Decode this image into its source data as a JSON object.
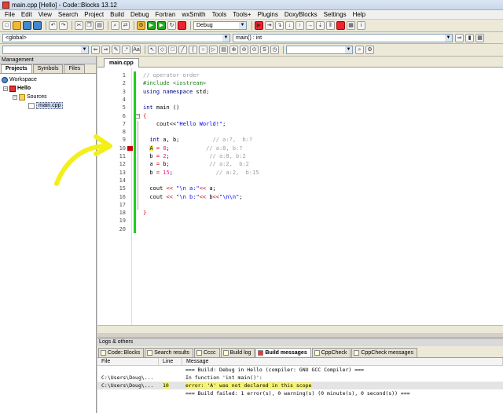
{
  "window": {
    "title": "main.cpp [Hello] - Code::Blocks 13.12"
  },
  "menu": [
    "File",
    "Edit",
    "View",
    "Search",
    "Project",
    "Build",
    "Debug",
    "Fortran",
    "wxSmith",
    "Tools",
    "Tools+",
    "Plugins",
    "DoxyBlocks",
    "Settings",
    "Help"
  ],
  "toolbar": {
    "build_target": "Debug",
    "scope": "<global>",
    "function": "main() : int"
  },
  "management": {
    "title": "Management",
    "tabs": [
      "Projects",
      "Symbols",
      "Files"
    ],
    "tree": {
      "workspace": "Workspace",
      "project": "Hello",
      "folder": "Sources",
      "file": "main.cpp"
    }
  },
  "editor": {
    "tab": "main.cpp",
    "lines": [
      [
        [
          "c-comment",
          "// operator order"
        ]
      ],
      [
        [
          "c-pre",
          "#include <iostream>"
        ]
      ],
      [
        [
          "c-kw",
          "using namespace"
        ],
        [
          "c-plain",
          " std;"
        ]
      ],
      [
        [
          "c-plain",
          ""
        ]
      ],
      [
        [
          "c-kw",
          "int"
        ],
        [
          "c-plain",
          " main ()"
        ]
      ],
      [
        [
          "c-op",
          "{"
        ]
      ],
      [
        [
          "c-plain",
          "    cout<<"
        ],
        [
          "c-str",
          "\"Hello World!\""
        ],
        [
          "c-plain",
          ";"
        ]
      ],
      [
        [
          "c-plain",
          ""
        ]
      ],
      [
        [
          "c-plain",
          "  "
        ],
        [
          "c-kw",
          "int"
        ],
        [
          "c-plain",
          " a, b;          "
        ],
        [
          "c-comment",
          "// a:?,  b:?"
        ]
      ],
      [
        [
          "c-plain",
          "  "
        ],
        [
          "c-plain hilite",
          "A"
        ],
        [
          "c-op",
          " = "
        ],
        [
          "c-num",
          "8"
        ],
        [
          "c-plain",
          ";           "
        ],
        [
          "c-comment",
          "// a:8, b:?"
        ]
      ],
      [
        [
          "c-plain",
          "  b "
        ],
        [
          "c-op",
          "="
        ],
        [
          "c-plain",
          " "
        ],
        [
          "c-num",
          "2"
        ],
        [
          "c-plain",
          ";            "
        ],
        [
          "c-comment",
          "// a:8, b:2"
        ]
      ],
      [
        [
          "c-plain",
          "  a "
        ],
        [
          "c-op",
          "="
        ],
        [
          "c-plain",
          " b;            "
        ],
        [
          "c-comment",
          "// a:2,  b:2"
        ]
      ],
      [
        [
          "c-plain",
          "  b "
        ],
        [
          "c-op",
          "="
        ],
        [
          "c-plain",
          " "
        ],
        [
          "c-num",
          "15"
        ],
        [
          "c-plain",
          ";             "
        ],
        [
          "c-comment",
          "// a:2,  b:15"
        ]
      ],
      [
        [
          "c-plain",
          ""
        ]
      ],
      [
        [
          "c-plain",
          "  cout "
        ],
        [
          "c-op",
          "<<"
        ],
        [
          "c-plain",
          " "
        ],
        [
          "c-str",
          "\"\\n a:\""
        ],
        [
          "c-op",
          "<<"
        ],
        [
          "c-plain",
          " a;"
        ]
      ],
      [
        [
          "c-plain",
          "  cout "
        ],
        [
          "c-op",
          "<<"
        ],
        [
          "c-plain",
          " "
        ],
        [
          "c-str",
          "\"\\n b:\""
        ],
        [
          "c-op",
          "<<"
        ],
        [
          "c-plain",
          " b"
        ],
        [
          "c-op",
          "<<"
        ],
        [
          "c-str",
          "\"\\n\\n\""
        ],
        [
          "c-plain",
          ";"
        ]
      ],
      [
        [
          "c-plain",
          ""
        ]
      ],
      [
        [
          "c-op",
          "}"
        ]
      ],
      [
        [
          "c-plain",
          ""
        ]
      ],
      [
        [
          "c-plain",
          ""
        ]
      ]
    ],
    "line_numbers": [
      "1",
      "2",
      "3",
      "4",
      "5",
      "6",
      "7",
      "8",
      "9",
      "10",
      "11",
      "12",
      "13",
      "14",
      "15",
      "16",
      "17",
      "18",
      "19",
      "20"
    ],
    "breakpoint_line": "10"
  },
  "logs": {
    "title": "Logs & others",
    "tabs": [
      "Code::Blocks",
      "Search results",
      "Cccc",
      "Build log",
      "Build messages",
      "CppCheck",
      "CppCheck messages"
    ],
    "active_tab": "Build messages",
    "columns": [
      "File",
      "Line",
      "Message"
    ],
    "rows": [
      {
        "file": "",
        "line": "",
        "msg": "=== Build: Debug in Hello (compiler: GNU GCC Compiler) ==="
      },
      {
        "file": "C:\\Users\\Doug\\...",
        "line": "",
        "msg": "In function 'int main()':"
      },
      {
        "file": "C:\\Users\\Doug\\...",
        "line": "10",
        "msg": "error: 'A' was not declared in this scope"
      },
      {
        "file": "",
        "line": "",
        "msg": "=== Build failed: 1 error(s), 0 warning(s) (0 minute(s), 0 second(s)) ==="
      }
    ]
  },
  "colors": {
    "annotation": "#f2ef1a",
    "breakpoint": "#cc0000",
    "changebar": "#22cc22"
  }
}
